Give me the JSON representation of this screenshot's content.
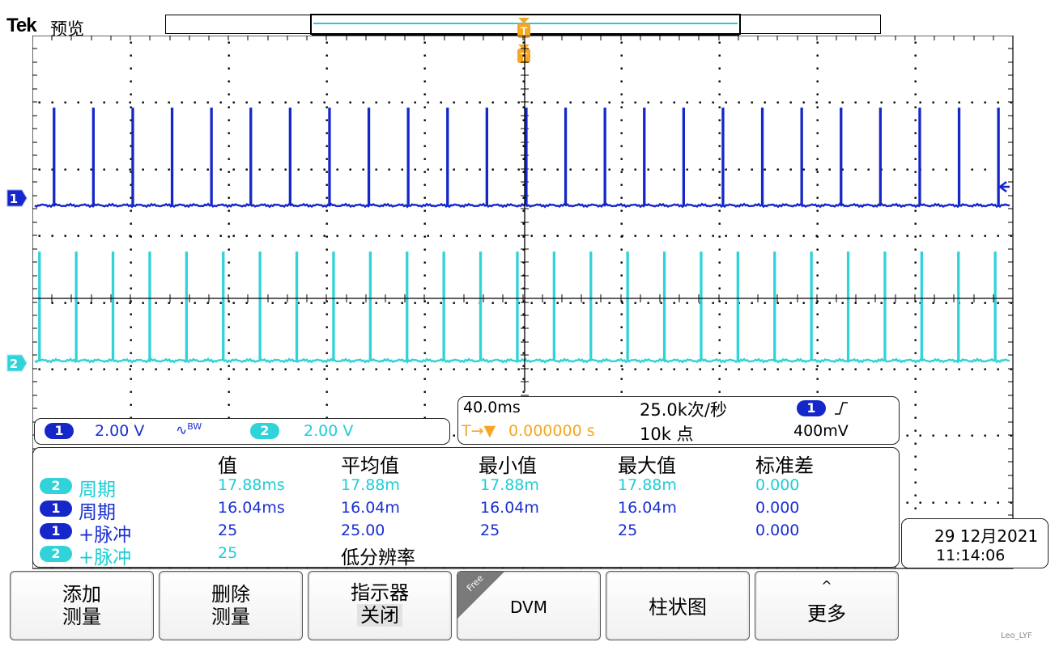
{
  "header": {
    "logo": "Tek",
    "mode": "预览",
    "trigger_marker": "T"
  },
  "colors": {
    "ch1": "#1527c9",
    "ch2": "#2fd3d9",
    "trigger": "#f5a623",
    "grid": "#000000"
  },
  "channels": [
    {
      "id": "1",
      "marker": "1",
      "scale": "2.00 V",
      "bw_limit_icon": "bandwidth-limit-icon",
      "bw_label": "BW"
    },
    {
      "id": "2",
      "marker": "2",
      "scale": "2.00 V"
    }
  ],
  "timebase": {
    "horizontal_scale": "40.0ms",
    "sample_rate": "25.0k次/秒",
    "trigger_position_prefix": "T→▼",
    "trigger_position": "0.000000 s",
    "record_length": "10k 点",
    "trigger_source": "1",
    "trigger_slope": "rising-edge-icon",
    "trigger_level": "400mV"
  },
  "measurements": {
    "headers": [
      "值",
      "平均值",
      "最小值",
      "最大值",
      "标准差"
    ],
    "rows": [
      {
        "channel": "2",
        "name": "周期",
        "value": "17.88ms",
        "mean": "17.88m",
        "min": "17.88m",
        "max": "17.88m",
        "stddev": "0.000"
      },
      {
        "channel": "1",
        "name": "周期",
        "value": "16.04ms",
        "mean": "16.04m",
        "min": "16.04m",
        "max": "16.04m",
        "stddev": "0.000"
      },
      {
        "channel": "1",
        "name": "+脉冲",
        "value": "25",
        "mean": "25.00",
        "min": "25",
        "max": "25",
        "stddev": "0.000"
      },
      {
        "channel": "2",
        "name": "+脉冲",
        "value": "25",
        "mean": "低分辨率",
        "min": "",
        "max": "",
        "stddev": ""
      }
    ]
  },
  "datetime": {
    "date": "29 12月2021",
    "time": "11:14:06"
  },
  "menu": {
    "buttons": [
      {
        "line1": "添加",
        "line2": "测量"
      },
      {
        "line1": "删除",
        "line2": "测量"
      },
      {
        "line1": "指示器",
        "line2": "关闭"
      },
      {
        "label": "DVM",
        "badge": "Free"
      },
      {
        "label": "柱状图"
      },
      {
        "label": "更多",
        "arrow": "^"
      }
    ]
  },
  "watermark": "Leo_LYF"
}
